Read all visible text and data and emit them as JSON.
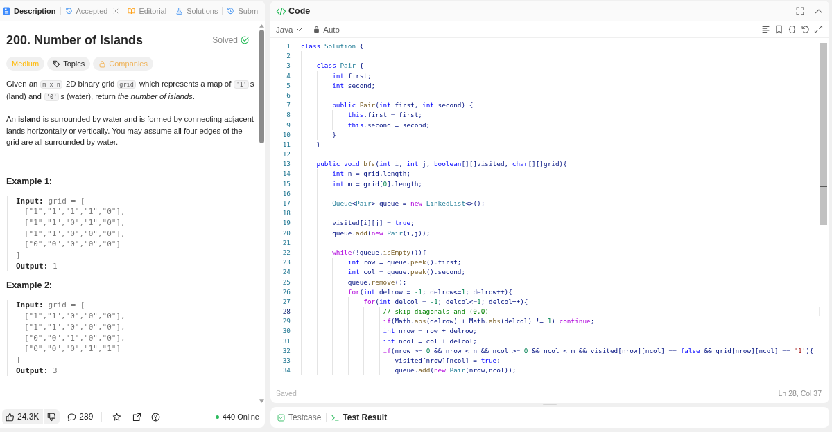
{
  "problem_panel": {
    "tabs": [
      {
        "label": "Description",
        "selected": true,
        "closable": false
      },
      {
        "label": "Accepted",
        "selected": false,
        "closable": true
      },
      {
        "label": "Editorial",
        "selected": false,
        "closable": false
      },
      {
        "label": "Solutions",
        "selected": false,
        "closable": false
      },
      {
        "label": "Subm",
        "selected": false,
        "closable": false
      }
    ],
    "title": "200. Number of Islands",
    "status": "Solved",
    "tags": [
      {
        "kind": "difficulty",
        "label": "Medium"
      },
      {
        "kind": "topics",
        "label": "Topics"
      },
      {
        "kind": "companies",
        "label": "Companies"
      }
    ],
    "description": [
      {
        "segments": [
          {
            "kind": "text",
            "text": "Given an "
          },
          {
            "kind": "code",
            "text": "m x n"
          },
          {
            "kind": "text",
            "text": " 2D binary grid "
          },
          {
            "kind": "code",
            "text": "grid"
          },
          {
            "kind": "text",
            "text": " which represents a map of "
          },
          {
            "kind": "code",
            "text": "'1'"
          },
          {
            "kind": "text",
            "text": "s (land) and "
          },
          {
            "kind": "code",
            "text": "'0'"
          },
          {
            "kind": "text",
            "text": "s (water), return *the number of islands*."
          }
        ]
      },
      {
        "segments": [
          {
            "kind": "text",
            "text": "An **island** is surrounded by water and is formed by connecting adjacent lands horizontally or vertically. You may assume all four edges of the grid are all surrounded by water."
          }
        ]
      }
    ],
    "examples": [
      {
        "heading": "Example 1:",
        "input_label": "Input:",
        "input_value": "grid = [",
        "rows": [
          "[\"1\",\"1\",\"1\",\"1\",\"0\"],",
          "[\"1\",\"1\",\"0\",\"1\",\"0\"],",
          "[\"1\",\"1\",\"0\",\"0\",\"0\"],",
          "[\"0\",\"0\",\"0\",\"0\",\"0\"]"
        ],
        "closing": "]",
        "output_label": "Output:",
        "output_value": "1"
      },
      {
        "heading": "Example 2:",
        "input_label": "Input:",
        "input_value": "grid = [",
        "rows": [
          "[\"1\",\"1\",\"0\",\"0\",\"0\"],",
          "[\"1\",\"1\",\"0\",\"0\",\"0\"],",
          "[\"0\",\"0\",\"1\",\"0\",\"0\"],",
          "[\"0\",\"0\",\"0\",\"1\",\"1\"]"
        ],
        "closing": "]",
        "output_label": "Output:",
        "output_value": "3"
      }
    ],
    "footer": {
      "likes": "24.3K",
      "comments": "289",
      "online": "440 Online"
    }
  },
  "editor": {
    "title": "Code",
    "language": "Java",
    "mode": "Auto",
    "lines": [
      {
        "number": "1",
        "active": false,
        "tokens": [
          {
            "kind": "keyword",
            "text": "class "
          },
          {
            "kind": "type",
            "text": "Solution"
          },
          {
            "kind": "plain",
            "text": " {"
          }
        ]
      },
      {
        "number": "2",
        "active": false
      },
      {
        "number": "3",
        "active": false,
        "tokens": [
          {
            "kind": "keyword",
            "text": "    class "
          },
          {
            "kind": "type",
            "text": "Pair"
          },
          {
            "kind": "plain",
            "text": " {"
          }
        ]
      },
      {
        "number": "4",
        "active": false,
        "tokens": [
          {
            "kind": "keyword",
            "text": "        int "
          },
          {
            "kind": "plain",
            "text": "first;"
          }
        ]
      },
      {
        "number": "5",
        "active": false,
        "tokens": [
          {
            "kind": "keyword",
            "text": "        int "
          },
          {
            "kind": "plain",
            "text": "second;"
          }
        ]
      },
      {
        "number": "6",
        "active": false
      },
      {
        "number": "7",
        "active": false,
        "tokens": [
          {
            "kind": "keyword",
            "text": "        public "
          },
          {
            "kind": "function",
            "text": "Pair"
          },
          {
            "kind": "plain",
            "text": "("
          },
          {
            "kind": "keyword",
            "text": "int "
          },
          {
            "kind": "plain",
            "text": "first, "
          },
          {
            "kind": "keyword",
            "text": "int "
          },
          {
            "kind": "plain",
            "text": "second) {"
          }
        ]
      },
      {
        "number": "8",
        "active": false,
        "tokens": [
          {
            "kind": "keyword",
            "text": "            this"
          },
          {
            "kind": "plain",
            "text": ".first = first;"
          }
        ]
      },
      {
        "number": "9",
        "active": false,
        "tokens": [
          {
            "kind": "keyword",
            "text": "            this"
          },
          {
            "kind": "plain",
            "text": ".second = second;"
          }
        ]
      },
      {
        "number": "10",
        "active": false,
        "tokens": [
          {
            "kind": "plain",
            "text": "        }"
          }
        ]
      },
      {
        "number": "11",
        "active": false,
        "tokens": [
          {
            "kind": "plain",
            "text": "    }"
          }
        ]
      },
      {
        "number": "12",
        "active": false
      },
      {
        "number": "13",
        "active": false,
        "tokens": [
          {
            "kind": "keyword",
            "text": "    public void "
          },
          {
            "kind": "function",
            "text": "bfs"
          },
          {
            "kind": "plain",
            "text": "("
          },
          {
            "kind": "keyword",
            "text": "int "
          },
          {
            "kind": "plain",
            "text": "i, "
          },
          {
            "kind": "keyword",
            "text": "int "
          },
          {
            "kind": "plain",
            "text": "j, "
          },
          {
            "kind": "keyword",
            "text": "boolean"
          },
          {
            "kind": "plain",
            "text": "[][]visited, "
          },
          {
            "kind": "keyword",
            "text": "char"
          },
          {
            "kind": "plain",
            "text": "[][]grid){"
          }
        ]
      },
      {
        "number": "14",
        "active": false,
        "tokens": [
          {
            "kind": "keyword",
            "text": "        int "
          },
          {
            "kind": "plain",
            "text": "n = grid.length;"
          }
        ]
      },
      {
        "number": "15",
        "active": false,
        "tokens": [
          {
            "kind": "keyword",
            "text": "        int "
          },
          {
            "kind": "plain",
            "text": "m = grid["
          },
          {
            "kind": "number",
            "text": "0"
          },
          {
            "kind": "plain",
            "text": "].length;"
          }
        ]
      },
      {
        "number": "16",
        "active": false
      },
      {
        "number": "17",
        "active": false,
        "tokens": [
          {
            "kind": "type",
            "text": "        Queue"
          },
          {
            "kind": "plain",
            "text": "<"
          },
          {
            "kind": "type",
            "text": "Pair"
          },
          {
            "kind": "plain",
            "text": "> queue = "
          },
          {
            "kind": "control",
            "text": "new "
          },
          {
            "kind": "type",
            "text": "LinkedList"
          },
          {
            "kind": "plain",
            "text": "<>();"
          }
        ]
      },
      {
        "number": "18",
        "active": false
      },
      {
        "number": "19",
        "active": false,
        "tokens": [
          {
            "kind": "plain",
            "text": "        visited[i][j] = "
          },
          {
            "kind": "keyword",
            "text": "true"
          },
          {
            "kind": "plain",
            "text": ";"
          }
        ]
      },
      {
        "number": "20",
        "active": false,
        "tokens": [
          {
            "kind": "plain",
            "text": "        queue."
          },
          {
            "kind": "function",
            "text": "add"
          },
          {
            "kind": "plain",
            "text": "("
          },
          {
            "kind": "control",
            "text": "new "
          },
          {
            "kind": "type",
            "text": "Pair"
          },
          {
            "kind": "plain",
            "text": "(i,j));"
          }
        ]
      },
      {
        "number": "21",
        "active": false
      },
      {
        "number": "22",
        "active": false,
        "tokens": [
          {
            "kind": "control",
            "text": "        while"
          },
          {
            "kind": "plain",
            "text": "(!queue."
          },
          {
            "kind": "function",
            "text": "isEmpty"
          },
          {
            "kind": "plain",
            "text": "()){"
          }
        ]
      },
      {
        "number": "23",
        "active": false,
        "tokens": [
          {
            "kind": "keyword",
            "text": "            int "
          },
          {
            "kind": "plain",
            "text": "row = queue."
          },
          {
            "kind": "function",
            "text": "peek"
          },
          {
            "kind": "plain",
            "text": "().first;"
          }
        ]
      },
      {
        "number": "24",
        "active": false,
        "tokens": [
          {
            "kind": "keyword",
            "text": "            int "
          },
          {
            "kind": "plain",
            "text": "col = queue."
          },
          {
            "kind": "function",
            "text": "peek"
          },
          {
            "kind": "plain",
            "text": "().second;"
          }
        ]
      },
      {
        "number": "25",
        "active": false,
        "tokens": [
          {
            "kind": "plain",
            "text": "            queue."
          },
          {
            "kind": "function",
            "text": "remove"
          },
          {
            "kind": "plain",
            "text": "();"
          }
        ]
      },
      {
        "number": "26",
        "active": false,
        "tokens": [
          {
            "kind": "control",
            "text": "            for"
          },
          {
            "kind": "plain",
            "text": "("
          },
          {
            "kind": "keyword",
            "text": "int "
          },
          {
            "kind": "plain",
            "text": "delrow = "
          },
          {
            "kind": "number",
            "text": "-1"
          },
          {
            "kind": "plain",
            "text": "; delrow<="
          },
          {
            "kind": "number",
            "text": "1"
          },
          {
            "kind": "plain",
            "text": "; delrow++){"
          }
        ]
      },
      {
        "number": "27",
        "active": false,
        "tokens": [
          {
            "kind": "control",
            "text": "                for"
          },
          {
            "kind": "plain",
            "text": "("
          },
          {
            "kind": "keyword",
            "text": "int "
          },
          {
            "kind": "plain",
            "text": "delcol = "
          },
          {
            "kind": "number",
            "text": "-1"
          },
          {
            "kind": "plain",
            "text": "; delcol<="
          },
          {
            "kind": "number",
            "text": "1"
          },
          {
            "kind": "plain",
            "text": "; delcol++){"
          }
        ]
      },
      {
        "number": "28",
        "active": true,
        "tokens": [
          {
            "kind": "comment",
            "text": "                     // skip diagonals and (0,0)"
          }
        ]
      },
      {
        "number": "29",
        "active": false,
        "tokens": [
          {
            "kind": "control",
            "text": "                     if"
          },
          {
            "kind": "plain",
            "text": "(Math."
          },
          {
            "kind": "function",
            "text": "abs"
          },
          {
            "kind": "plain",
            "text": "(delrow) + Math."
          },
          {
            "kind": "function",
            "text": "abs"
          },
          {
            "kind": "plain",
            "text": "(delcol) != "
          },
          {
            "kind": "number",
            "text": "1"
          },
          {
            "kind": "plain",
            "text": ") "
          },
          {
            "kind": "control",
            "text": "continue"
          },
          {
            "kind": "plain",
            "text": ";"
          }
        ]
      },
      {
        "number": "30",
        "active": false,
        "tokens": [
          {
            "kind": "keyword",
            "text": "                     int "
          },
          {
            "kind": "plain",
            "text": "nrow = row + delrow;"
          }
        ]
      },
      {
        "number": "31",
        "active": false,
        "tokens": [
          {
            "kind": "keyword",
            "text": "                     int "
          },
          {
            "kind": "plain",
            "text": "ncol = col + delcol;"
          }
        ]
      },
      {
        "number": "32",
        "active": false,
        "tokens": [
          {
            "kind": "control",
            "text": "                     if"
          },
          {
            "kind": "plain",
            "text": "(nrow >= "
          },
          {
            "kind": "number",
            "text": "0"
          },
          {
            "kind": "plain",
            "text": " && nrow < n && ncol >= "
          },
          {
            "kind": "number",
            "text": "0"
          },
          {
            "kind": "plain",
            "text": " && ncol < m && visited[nrow][ncol] == "
          },
          {
            "kind": "keyword",
            "text": "false"
          },
          {
            "kind": "plain",
            "text": " && grid[nrow][ncol] == "
          },
          {
            "kind": "string",
            "text": "'1'"
          },
          {
            "kind": "plain",
            "text": "){"
          }
        ]
      },
      {
        "number": "33",
        "active": false,
        "tokens": [
          {
            "kind": "plain",
            "text": "                        visited[nrow][ncol] = "
          },
          {
            "kind": "keyword",
            "text": "true"
          },
          {
            "kind": "plain",
            "text": ";"
          }
        ]
      },
      {
        "number": "34",
        "active": false,
        "tokens": [
          {
            "kind": "plain",
            "text": "                        queue."
          },
          {
            "kind": "function",
            "text": "add"
          },
          {
            "kind": "plain",
            "text": "("
          },
          {
            "kind": "control",
            "text": "new "
          },
          {
            "kind": "type",
            "text": "Pair"
          },
          {
            "kind": "plain",
            "text": "(nrow,ncol));"
          }
        ]
      }
    ],
    "status": "Saved",
    "cursor": "Ln 28, Col 37"
  },
  "console": {
    "tabs": [
      {
        "label": "Testcase",
        "selected": false
      },
      {
        "label": "Test Result",
        "selected": true
      }
    ]
  }
}
